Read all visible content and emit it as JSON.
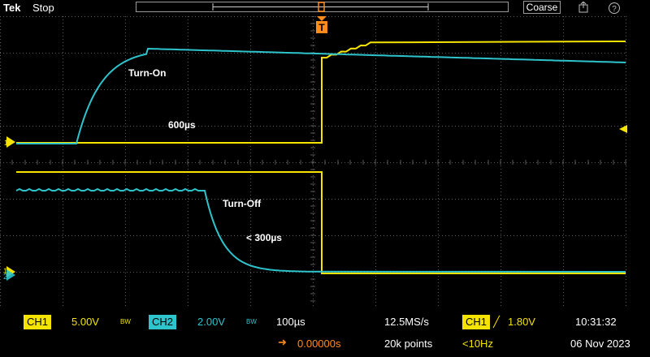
{
  "topbar": {
    "brand": "Tek",
    "acquisition_state": "Stop",
    "coarse_label": "Coarse",
    "icons": [
      "save-icon",
      "help-icon"
    ],
    "help_glyph": "?"
  },
  "screen": {
    "trigger_marker": "T",
    "annotations": {
      "turn_on": "Turn-On",
      "turn_on_time": "600µs",
      "turn_off": "Turn-Off",
      "turn_off_time": "< 300µs"
    },
    "channel_marker_1": "1",
    "channel_marker_2": "2",
    "colors": {
      "ch1": "#f5e400",
      "ch2": "#2ec4cc",
      "trigger": "#ff8c1a",
      "grid": "#5a5a5a"
    }
  },
  "bottombar": {
    "ch1_label": "CH1",
    "ch1_scale": "5.00V",
    "ch1_bw": "BW",
    "ch2_label": "CH2",
    "ch2_scale": "2.00V",
    "ch2_bw": "BW",
    "timebase": "100µs",
    "trigger_position": "0.00000s",
    "sample_rate": "12.5MS/s",
    "record_length": "20k points",
    "trigger_source": "CH1",
    "trigger_slope": "╱",
    "trigger_level": "1.80V",
    "trigger_freq": "<10Hz",
    "time": "10:31:32",
    "date": "06 Nov 2023"
  }
}
